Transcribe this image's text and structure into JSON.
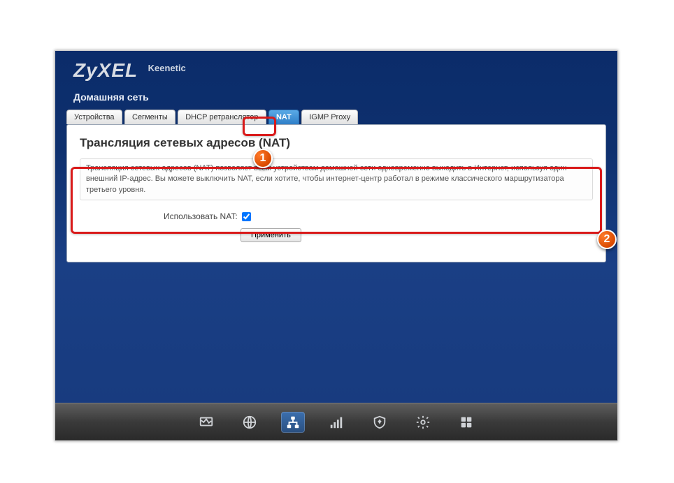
{
  "brand": "ZyXEL",
  "model": "Keenetic",
  "section": "Домашняя сеть",
  "tabs": [
    {
      "label": "Устройства"
    },
    {
      "label": "Сегменты"
    },
    {
      "label": "DHCP ретранслятор"
    },
    {
      "label": "NAT",
      "active": true
    },
    {
      "label": "IGMP Proxy"
    }
  ],
  "page": {
    "title": "Трансляция сетевых адресов (NAT)",
    "description": "Трансляция сетевых адресов (NAT) позволяет всем устройствам домашней сети одновременно выходить в Интернет, используя один внешний IP-адрес. Вы можете выключить NAT, если хотите, чтобы интернет-центр работал в режиме классического маршрутизатора третьего уровня.",
    "checkbox_label": "Использовать NAT:",
    "checkbox_checked": true,
    "apply_label": "Применить"
  },
  "callouts": {
    "badge1": "1",
    "badge2": "2"
  },
  "dock": [
    {
      "name": "monitor-icon"
    },
    {
      "name": "globe-icon"
    },
    {
      "name": "network-icon",
      "active": true
    },
    {
      "name": "signal-icon"
    },
    {
      "name": "shield-icon"
    },
    {
      "name": "gear-icon"
    },
    {
      "name": "apps-icon"
    }
  ]
}
